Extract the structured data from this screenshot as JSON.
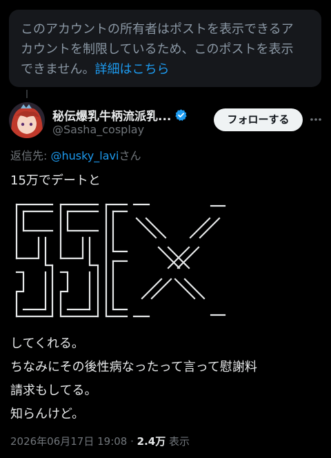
{
  "notice": {
    "text_line1": "このアカウントの所有者はポストを表示できるア",
    "text_line2": "カウントを制限しているため、このポストを表示",
    "text_line3": "できません。",
    "link": "詳細はこちら"
  },
  "author": {
    "display_name": "秘伝爆乳牛柄流派乳...",
    "handle": "@Sasha_cosplay",
    "follow_label": "フォローする"
  },
  "reply": {
    "prefix": "返信先: ",
    "mention": "@husky_lavi",
    "suffix": "さん"
  },
  "post": {
    "line1": "15万でデートと",
    "line2": "してくれる。",
    "line3": "ちなみにその後性病なったって言って慰謝料",
    "line4": "請求もしてる。",
    "line5": "知らんけど。"
  },
  "meta": {
    "timestamp": "2026年06月17日 19:08",
    "separator": " · ",
    "views": "2.4万",
    "views_label": " 表示"
  },
  "colors": {
    "accent": "#1d9bf0",
    "background": "#000000",
    "card": "#16181c"
  }
}
